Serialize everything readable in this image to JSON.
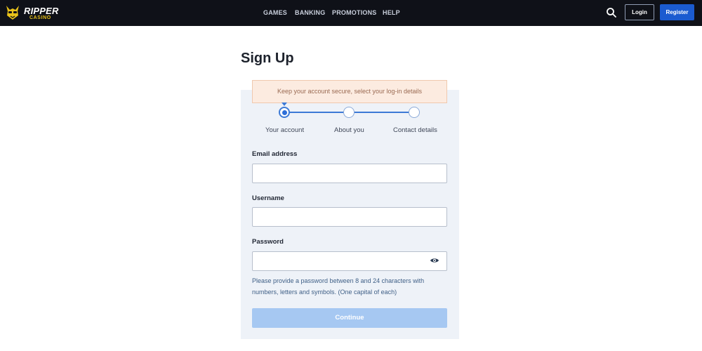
{
  "brand": {
    "name": "RIPPER",
    "sub": "CASINO",
    "accent": "#e9c21a"
  },
  "nav": {
    "items": [
      {
        "label": "GAMES"
      },
      {
        "label": "BANKING"
      },
      {
        "label": "PROMOTIONS"
      },
      {
        "label": "HELP"
      }
    ]
  },
  "header_actions": {
    "search_icon": "search-icon",
    "login_label": "Login",
    "register_label": "Register",
    "register_color": "#1b5bd0"
  },
  "page": {
    "title": "Sign Up"
  },
  "form": {
    "notice": "Keep your account secure, select your log-in details",
    "steps": [
      {
        "label": "Your account",
        "active": true
      },
      {
        "label": "About you",
        "active": false
      },
      {
        "label": "Contact details",
        "active": false
      }
    ],
    "email": {
      "label": "Email address",
      "value": "",
      "placeholder": ""
    },
    "username": {
      "label": "Username",
      "value": "",
      "placeholder": ""
    },
    "password": {
      "label": "Password",
      "value": "",
      "placeholder": "",
      "icon": "eye-icon"
    },
    "password_hint": "Please provide a password between 8 and 24 characters with numbers, letters and symbols. (One capital of each)",
    "continue_label": "Continue"
  }
}
